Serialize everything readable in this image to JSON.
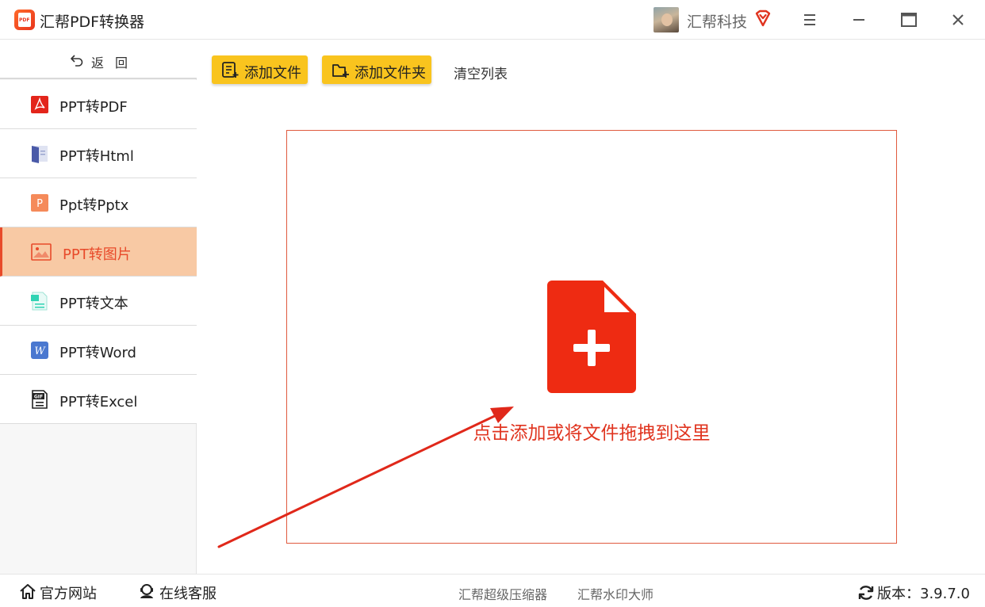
{
  "titlebar": {
    "app_title": "汇帮PDF转换器",
    "logo_text": "PDF",
    "user_name": "汇帮科技"
  },
  "sidebar": {
    "back_label": "返回",
    "items": [
      {
        "label": "PPT转PDF",
        "icon": "pdf-icon",
        "active": false
      },
      {
        "label": "PPT转Html",
        "icon": "html-icon",
        "active": false
      },
      {
        "label": "Ppt转Pptx",
        "icon": "pptx-icon",
        "active": false
      },
      {
        "label": "PPT转图片",
        "icon": "image-icon",
        "active": true
      },
      {
        "label": "PPT转文本",
        "icon": "text-doc-icon",
        "active": false
      },
      {
        "label": "PPT转Word",
        "icon": "word-icon",
        "active": false
      },
      {
        "label": "PPT转Excel",
        "icon": "gif-icon",
        "active": false
      }
    ]
  },
  "toolbar": {
    "add_file": "添加文件",
    "add_folder": "添加文件夹",
    "clear_list": "清空列表"
  },
  "dropzone": {
    "hint": "点击添加或将文件拖拽到这里"
  },
  "footer": {
    "website": "官方网站",
    "support": "在线客服",
    "link1": "汇帮超级压缩器",
    "link2": "汇帮水印大师",
    "version": "版本：3.9.7.0"
  },
  "colors": {
    "accent": "#e84a2a",
    "toolbar_button": "#f9c41e",
    "active_nav_bg": "#f8c9a4",
    "drop_icon": "#ee2b12"
  }
}
